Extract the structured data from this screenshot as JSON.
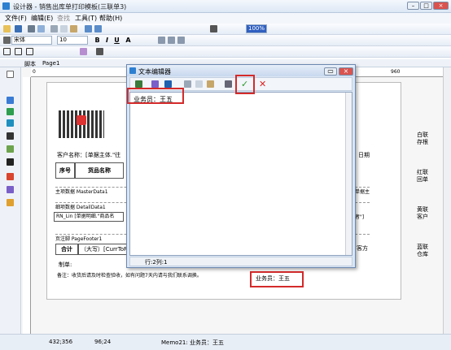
{
  "window": {
    "title": "设计器 - 销售出库单打印模板(三联单3)"
  },
  "menu": [
    "文件(F)",
    "编辑(E)",
    "查找",
    "工具(T)",
    "帮助(H)"
  ],
  "toolbar": {
    "font": "宋体",
    "size": "10",
    "color_combo": "100%"
  },
  "tabs": [
    "脚本",
    "Page1"
  ],
  "ruler_marks": [
    "0",
    "960"
  ],
  "report": {
    "customer_label": "客户名称：[单据主体.\"往",
    "date_label": "日期",
    "col_seq": "序号",
    "col_name": "货品名称",
    "master_band": "主项数据 MasterData1",
    "detail_band": "细项数据 DetailData1",
    "row_text": "RN_Lin [单据明细.\"商品名",
    "row_tail": "者\"]",
    "master_tail": "单据主",
    "footer_band": "页注脚 PageFooter1",
    "total_label": "合计",
    "total_upper": "（大写）[CurrToRM",
    "total_tail": "客方",
    "maker_label": "制单:",
    "note": "备注：收货后请及时检查验收，如有问题7天内请与我们联系调换。",
    "salesman_memo": "业务员：王五",
    "side_copies": [
      "白联存根",
      "红联回单",
      "黄联客户",
      "蓝联仓库"
    ]
  },
  "dialog": {
    "title": "文本编辑器",
    "content": "业务员：王五",
    "status": "行:2列:1"
  },
  "status": {
    "pos1": "432;356",
    "pos2": "96;24",
    "memo": "Memo21: 业务员：王五"
  }
}
